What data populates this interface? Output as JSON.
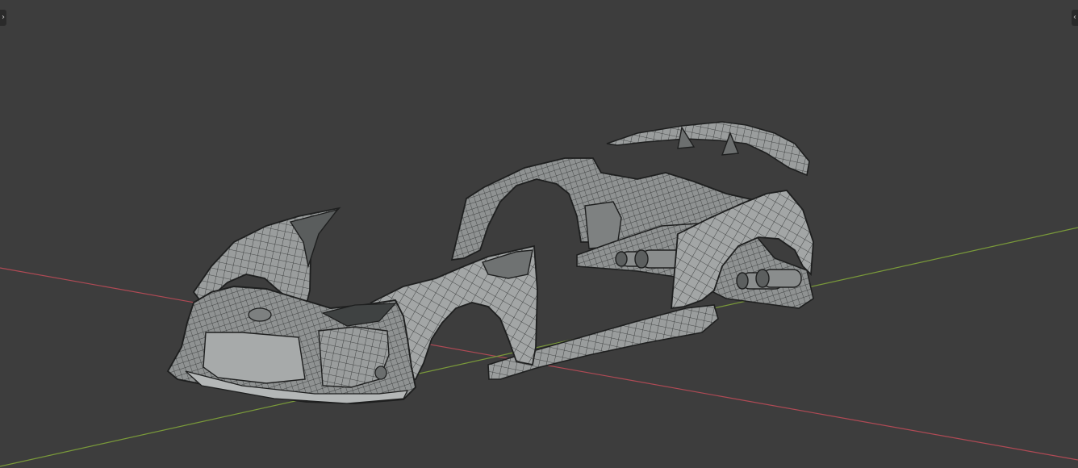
{
  "viewport": {
    "background": "#3d3d3d",
    "x_axis_color": "#b04a55",
    "y_axis_color": "#7a9a3a",
    "mesh_fill": "#9a9d9d",
    "mesh_wire": "#2a2c2c",
    "mesh_highlight": "#b9bcbc"
  },
  "toolbar_left": {
    "icon": "chevron-right-icon",
    "glyph": "›"
  },
  "sidebar_right": {
    "icon": "chevron-left-icon",
    "glyph": "‹"
  },
  "scene": {
    "object": "car-body-kit-wireframe",
    "parts": [
      "front-bumper",
      "hood-fenders",
      "front-fender",
      "side-skirt",
      "rear-quarter",
      "rear-diffuser-exhaust",
      "rear-fender",
      "rear-wing"
    ]
  }
}
